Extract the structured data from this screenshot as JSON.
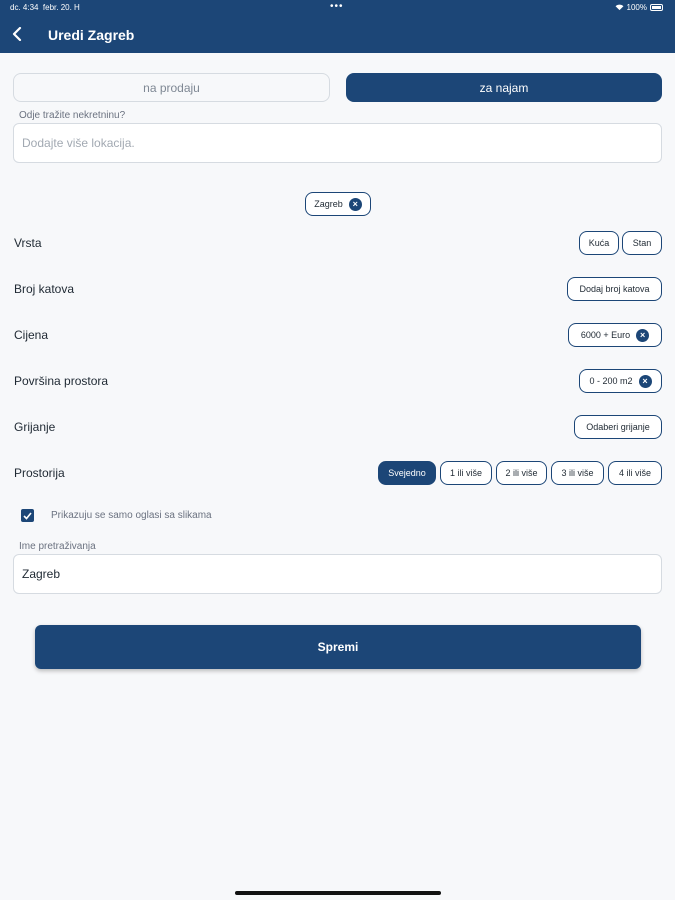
{
  "status": {
    "time": "dc. 4:34",
    "date": "febr. 20. H",
    "battery": "100%",
    "dots": "•••"
  },
  "header": {
    "title": "Uredi Zagreb"
  },
  "tabs": {
    "sale": "na prodaju",
    "rent": "za najam"
  },
  "location": {
    "label": "Odje tražite nekretninu?",
    "placeholder": "Dodajte više lokacija."
  },
  "selected_location_chip": "Zagreb",
  "filters": {
    "vrsta": {
      "label": "Vrsta",
      "options": [
        "Kuća",
        "Stan"
      ]
    },
    "katovi": {
      "label": "Broj katova",
      "button": "Dodaj broj katova"
    },
    "cijena": {
      "label": "Cijena",
      "value": "6000 + Euro"
    },
    "povrsina": {
      "label": "Površina prostora",
      "value": "0 - 200 m2"
    },
    "grijanje": {
      "label": "Grijanje",
      "button": "Odaberi grijanje"
    },
    "prostorija": {
      "label": "Prostorija",
      "options": [
        "Svejedno",
        "1 ili više",
        "2 ili više",
        "3 ili više",
        "4 ili više"
      ],
      "selected": "Svejedno"
    }
  },
  "photos_only": {
    "label": "Prikazuju se samo oglasi sa slikama",
    "checked": true
  },
  "search_name": {
    "label": "Ime pretraživanja",
    "value": "Zagreb"
  },
  "save": {
    "label": "Spremi"
  },
  "colors": {
    "primary": "#1c4677",
    "background": "#f7f8fa",
    "border": "#d6dbe1"
  }
}
